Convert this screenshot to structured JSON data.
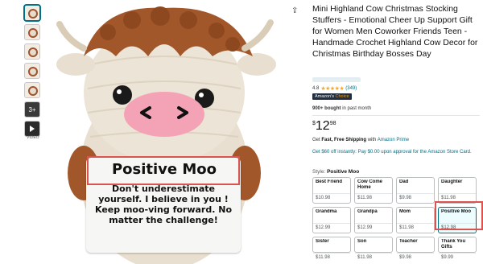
{
  "thumbnails": {
    "more_label": "3+",
    "video_label": "VIDEO"
  },
  "image_card": {
    "title": "Positive Moo",
    "message": "Don't underestimate yourself. I believe in you ! Keep moo-ving forward. No matter the challenge!"
  },
  "product": {
    "title": "Mini Highland Cow Christmas Stocking Stuffers - Emotional Cheer Up Support Gift for Women Men Coworker Friends Teen - Handmade Crochet Highland Cow Decor for Christmas Birthday Bosses Day",
    "rating_value": "4.8",
    "rating_stars": "★★★★★",
    "rating_count": "(349)",
    "badge_prefix": "Amazon's",
    "badge_suffix": "Choice",
    "bought_bold": "900+ bought",
    "bought_rest": "in past month",
    "price_symbol": "$",
    "price_whole": "12",
    "price_fraction": "98",
    "shipping_prefix": "Get ",
    "shipping_bold": "Fast, Free Shipping",
    "shipping_mid": " with ",
    "shipping_link": "Amazon Prime",
    "offer": "Get $60 off instantly: Pay $0.00 upon approval for the Amazon Store Card.",
    "style_label": "Style:",
    "style_value": "Positive Moo"
  },
  "styles": [
    {
      "name": "Best Friend",
      "price": "$10.98"
    },
    {
      "name": "Cow Come Home",
      "price": "$11.98"
    },
    {
      "name": "Dad",
      "price": "$9.98"
    },
    {
      "name": "Daughter",
      "price": "$11.98"
    },
    {
      "name": "Grandma",
      "price": "$12.99"
    },
    {
      "name": "Grandpa",
      "price": "$12.99"
    },
    {
      "name": "Mom",
      "price": "$11.98"
    },
    {
      "name": "Positive Moo",
      "price": "$12.98"
    },
    {
      "name": "Sister",
      "price": "$11.98"
    },
    {
      "name": "Son",
      "price": "$11.98"
    },
    {
      "name": "Teacher",
      "price": "$9.98"
    },
    {
      "name": "Thank You Gifts",
      "price": "$9.99"
    }
  ],
  "colors": {
    "link": "#007185",
    "highlight": "#d9534f",
    "star": "#ffa41c"
  }
}
